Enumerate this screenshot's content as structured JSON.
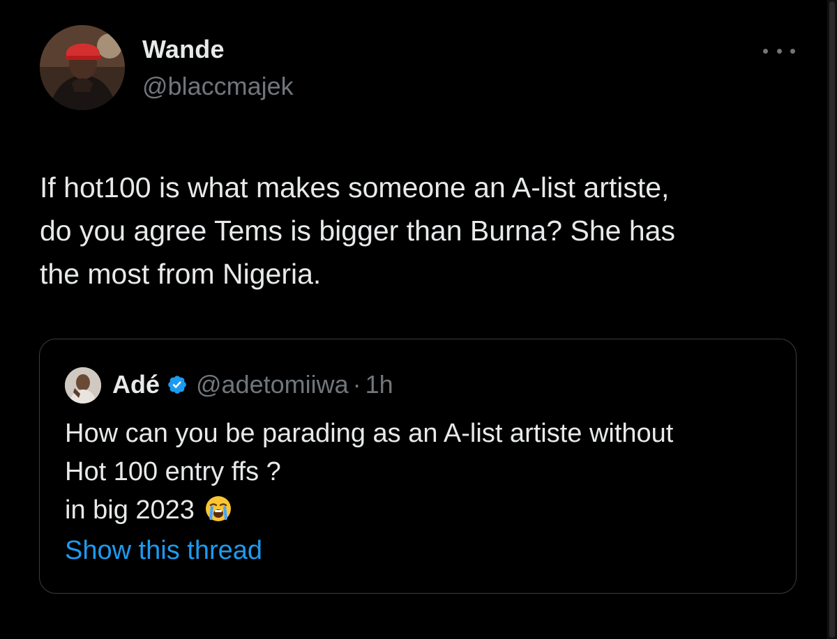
{
  "tweet": {
    "author": {
      "name": "Wande",
      "handle": "@blaccmajek",
      "avatar_icon": "user-avatar-red-cap"
    },
    "more_icon": "ellipsis-icon",
    "text": "If hot100 is what makes someone an A-list artiste,\ndo you agree Tems is bigger than Burna? She has\nthe most from Nigeria."
  },
  "quote": {
    "author": {
      "name": "Adé",
      "verified": true,
      "handle": "@adetomiiwa",
      "separator": "·",
      "time": "1h"
    },
    "lines": [
      "How can you be parading as an A-list artiste without",
      "Hot 100 entry ffs ?",
      "in big 2023"
    ],
    "emoji": "loudly-crying-face-icon",
    "show_thread_label": "Show this thread"
  },
  "colors": {
    "background": "#000000",
    "primary_text": "#e7e9ea",
    "secondary_text": "#71767b",
    "link": "#1d9bf0",
    "verified_badge": "#1d9bf0",
    "card_border": "#3a3d41"
  }
}
